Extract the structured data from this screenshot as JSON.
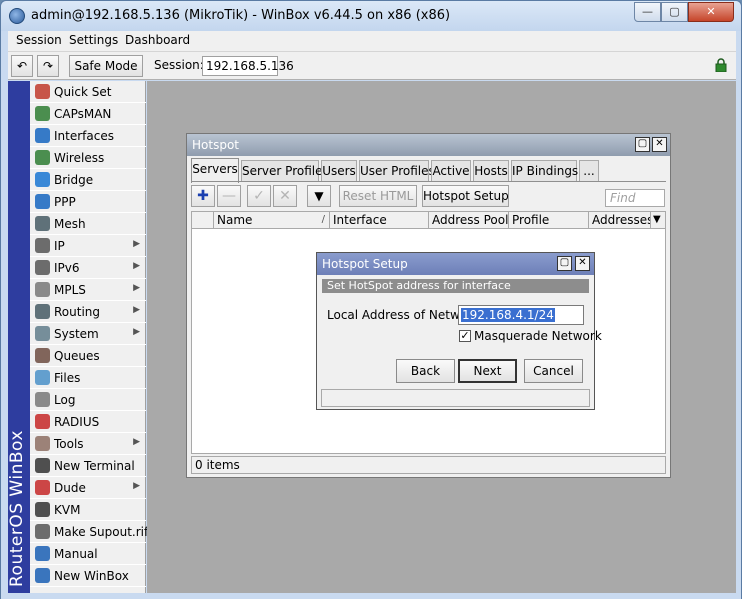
{
  "window": {
    "title": "admin@192.168.5.136 (MikroTik) - WinBox v6.44.5 on x86 (x86)",
    "min_glyph": "—",
    "max_glyph": "▢",
    "close_glyph": "✕"
  },
  "menubar": {
    "items": [
      "Session",
      "Settings",
      "Dashboard"
    ]
  },
  "toolbar": {
    "undo_glyph": "↶",
    "redo_glyph": "↷",
    "safe_mode": "Safe Mode",
    "session_label": "Session:",
    "session_value": "192.168.5.136"
  },
  "sidebar": {
    "brand": "RouterOS WinBox",
    "items": [
      {
        "label": "Quick Set",
        "icon": "quick-set-icon",
        "arrow": ""
      },
      {
        "label": "CAPsMAN",
        "icon": "antenna-icon",
        "arrow": ""
      },
      {
        "label": "Interfaces",
        "icon": "interfaces-icon",
        "arrow": ""
      },
      {
        "label": "Wireless",
        "icon": "wireless-icon",
        "arrow": ""
      },
      {
        "label": "Bridge",
        "icon": "bridge-icon",
        "arrow": ""
      },
      {
        "label": "PPP",
        "icon": "ppp-icon",
        "arrow": ""
      },
      {
        "label": "Mesh",
        "icon": "mesh-icon",
        "arrow": ""
      },
      {
        "label": "IP",
        "icon": "ip-icon",
        "arrow": "▶"
      },
      {
        "label": "IPv6",
        "icon": "ipv6-icon",
        "arrow": "▶"
      },
      {
        "label": "MPLS",
        "icon": "mpls-icon",
        "arrow": "▶"
      },
      {
        "label": "Routing",
        "icon": "routing-icon",
        "arrow": "▶"
      },
      {
        "label": "System",
        "icon": "gear-icon",
        "arrow": "▶"
      },
      {
        "label": "Queues",
        "icon": "queues-icon",
        "arrow": ""
      },
      {
        "label": "Files",
        "icon": "folder-icon",
        "arrow": ""
      },
      {
        "label": "Log",
        "icon": "log-icon",
        "arrow": ""
      },
      {
        "label": "RADIUS",
        "icon": "radius-icon",
        "arrow": ""
      },
      {
        "label": "Tools",
        "icon": "tools-icon",
        "arrow": "▶"
      },
      {
        "label": "New Terminal",
        "icon": "terminal-icon",
        "arrow": ""
      },
      {
        "label": "Dude",
        "icon": "dude-icon",
        "arrow": "▶"
      },
      {
        "label": "KVM",
        "icon": "kvm-icon",
        "arrow": ""
      },
      {
        "label": "Make Supout.rif",
        "icon": "document-icon",
        "arrow": ""
      },
      {
        "label": "Manual",
        "icon": "help-icon",
        "arrow": ""
      },
      {
        "label": "New WinBox",
        "icon": "winbox-icon",
        "arrow": ""
      }
    ]
  },
  "hotspot": {
    "title": "Hotspot",
    "restore_glyph": "▢",
    "close_glyph": "✕",
    "tabs": [
      "Servers",
      "Server Profiles",
      "Users",
      "User Profiles",
      "Active",
      "Hosts",
      "IP Bindings",
      "..."
    ],
    "add_glyph": "✚",
    "remove_glyph": "—",
    "enable_glyph": "✓",
    "disable_glyph": "✕",
    "filter_glyph": "▼",
    "reset_html": "Reset HTML",
    "hotspot_setup": "Hotspot Setup",
    "find_placeholder": "Find",
    "columns": [
      "Name",
      "Interface",
      "Address Pool",
      "Profile",
      "Addresses ..."
    ],
    "sort_glyph": "/",
    "dropdown_glyph": "▼",
    "status": "0 items"
  },
  "setup_dialog": {
    "title": "Hotspot Setup",
    "restore_glyph": "▢",
    "close_glyph": "✕",
    "subtitle": "Set HotSpot address for interface",
    "local_address_label": "Local Address of Network:",
    "local_address_value": "192.168.4.1/24",
    "masquerade_checked": "✓",
    "masquerade_label": "Masquerade Network",
    "back": "Back",
    "next": "Next",
    "cancel": "Cancel"
  }
}
